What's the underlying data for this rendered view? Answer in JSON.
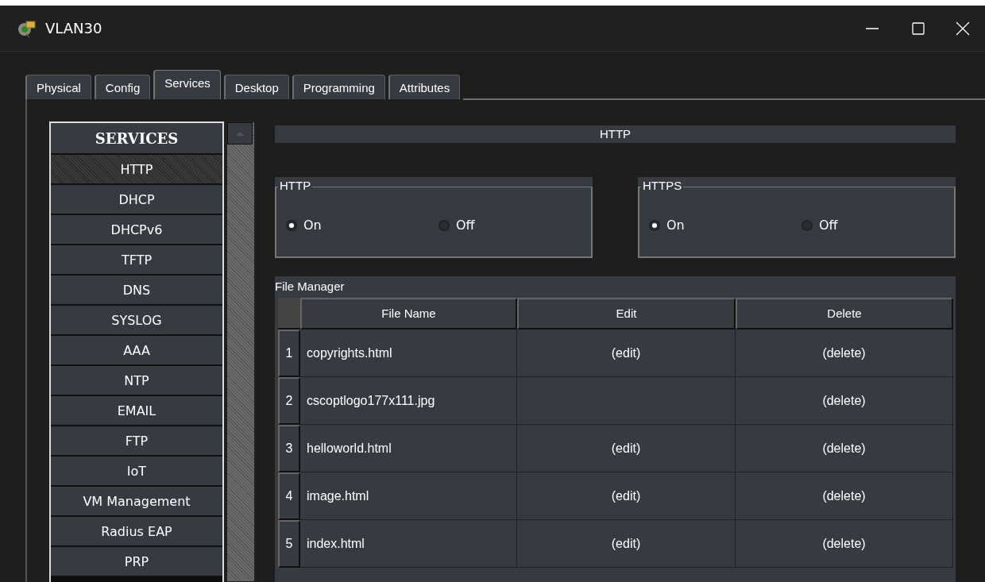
{
  "window": {
    "title": "VLAN30"
  },
  "tabs": [
    {
      "label": "Physical",
      "selected": false
    },
    {
      "label": "Config",
      "selected": false
    },
    {
      "label": "Services",
      "selected": true
    },
    {
      "label": "Desktop",
      "selected": false
    },
    {
      "label": "Programming",
      "selected": false
    },
    {
      "label": "Attributes",
      "selected": false
    }
  ],
  "sidebar": {
    "title": "SERVICES",
    "items": [
      {
        "label": "HTTP",
        "selected": true
      },
      {
        "label": "DHCP",
        "selected": false
      },
      {
        "label": "DHCPv6",
        "selected": false
      },
      {
        "label": "TFTP",
        "selected": false
      },
      {
        "label": "DNS",
        "selected": false
      },
      {
        "label": "SYSLOG",
        "selected": false
      },
      {
        "label": "AAA",
        "selected": false
      },
      {
        "label": "NTP",
        "selected": false
      },
      {
        "label": "EMAIL",
        "selected": false
      },
      {
        "label": "FTP",
        "selected": false
      },
      {
        "label": "IoT",
        "selected": false
      },
      {
        "label": "VM Management",
        "selected": false
      },
      {
        "label": "Radius EAP",
        "selected": false
      },
      {
        "label": "PRP",
        "selected": false
      }
    ]
  },
  "section_title": "HTTP",
  "groups": [
    {
      "legend": "HTTP",
      "options": [
        {
          "label": "On",
          "selected": true
        },
        {
          "label": "Off",
          "selected": false
        }
      ]
    },
    {
      "legend": "HTTPS",
      "options": [
        {
          "label": "On",
          "selected": true
        },
        {
          "label": "Off",
          "selected": false
        }
      ]
    }
  ],
  "file_manager": {
    "title": "File Manager",
    "columns": [
      "File Name",
      "Edit",
      "Delete"
    ],
    "rows": [
      {
        "number": "1",
        "name": "copyrights.html",
        "edit": "(edit)",
        "delete": "(delete)"
      },
      {
        "number": "2",
        "name": "cscoptlogo177x111.jpg",
        "delete": "(delete)"
      },
      {
        "number": "3",
        "name": "helloworld.html",
        "edit": "(edit)",
        "delete": "(delete)"
      },
      {
        "number": "4",
        "name": "image.html",
        "edit": "(edit)",
        "delete": "(delete)"
      },
      {
        "number": "5",
        "name": "index.html",
        "edit": "(edit)",
        "delete": "(delete)"
      }
    ]
  }
}
